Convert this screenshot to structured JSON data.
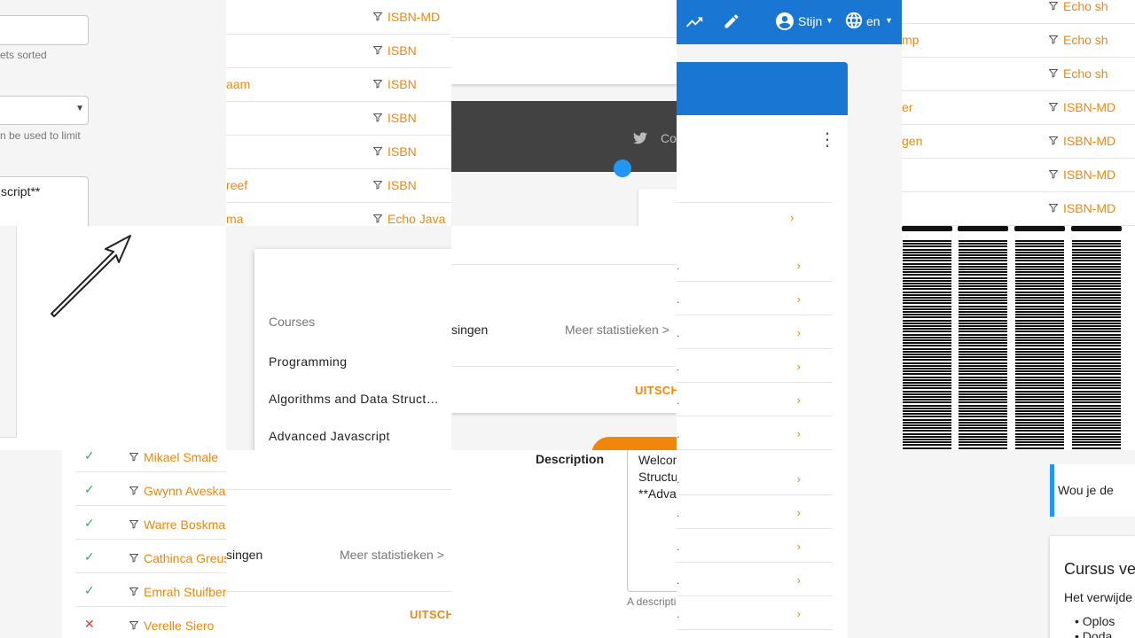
{
  "left_form": {
    "hint1": "ets sorted",
    "hint2": "n be used to limit",
    "textarea_text": "script**"
  },
  "isbn_panel": {
    "rows": [
      {
        "name": "",
        "tag": "ISBN-MD"
      },
      {
        "name": "",
        "tag": "ISBN"
      },
      {
        "name": "aam",
        "tag": "ISBN"
      },
      {
        "name": "",
        "tag": "ISBN"
      },
      {
        "name": "",
        "tag": "ISBN"
      },
      {
        "name": "reef",
        "tag": "ISBN"
      },
      {
        "name": "ma",
        "tag": "Echo Java"
      }
    ]
  },
  "dark_bar": {
    "link": "Co"
  },
  "header": {
    "user": "Stijn",
    "lang": "en"
  },
  "right_rows": [
    {
      "name": "",
      "tag": "Echo sh"
    },
    {
      "name": "mp",
      "tag": "Echo sh"
    },
    {
      "name": "",
      "tag": "Echo sh"
    },
    {
      "name": "er",
      "tag": "ISBN-MD"
    },
    {
      "name": "gen",
      "tag": "ISBN-MD"
    },
    {
      "name": "",
      "tag": "ISBN-MD"
    },
    {
      "name": "",
      "tag": "ISBN-MD"
    }
  ],
  "courses_menu": {
    "header": "Courses",
    "items": [
      "Programming",
      "Algorithms and Data Structures",
      "Advanced Javascript"
    ]
  },
  "stats_card_1": {
    "label": "singen",
    "more": "Meer statistieken >",
    "action": "UITSCH"
  },
  "stats_card_2": {
    "label": "singen",
    "more": "Meer statistieken >",
    "action": "UITSCH"
  },
  "students": [
    {
      "status": "ok",
      "name": "Mikael Smale"
    },
    {
      "status": "ok",
      "name": "Gwynn Aveska"
    },
    {
      "status": "ok",
      "name": "Warre Boskma"
    },
    {
      "status": "ok",
      "name": "Cathinca Greus"
    },
    {
      "status": "ok",
      "name": "Emrah Stuifber"
    },
    {
      "status": "fail",
      "name": "Verelle Siero"
    }
  ],
  "description": {
    "label": "Description",
    "text_lines": [
      "Welcom",
      "Structu",
      "**Adva"
    ],
    "hint": "A descripti"
  },
  "notice": {
    "text": "Wou je de"
  },
  "course_card": {
    "title": "Cursus ve",
    "body": "Het verwijde",
    "bullets": [
      "Oplos",
      "Doda"
    ]
  },
  "colors": {
    "accent": "#f0870c",
    "header_blue": "#1976d2",
    "dark_bar": "#424242",
    "success": "#3aa757",
    "danger": "#e53935"
  }
}
